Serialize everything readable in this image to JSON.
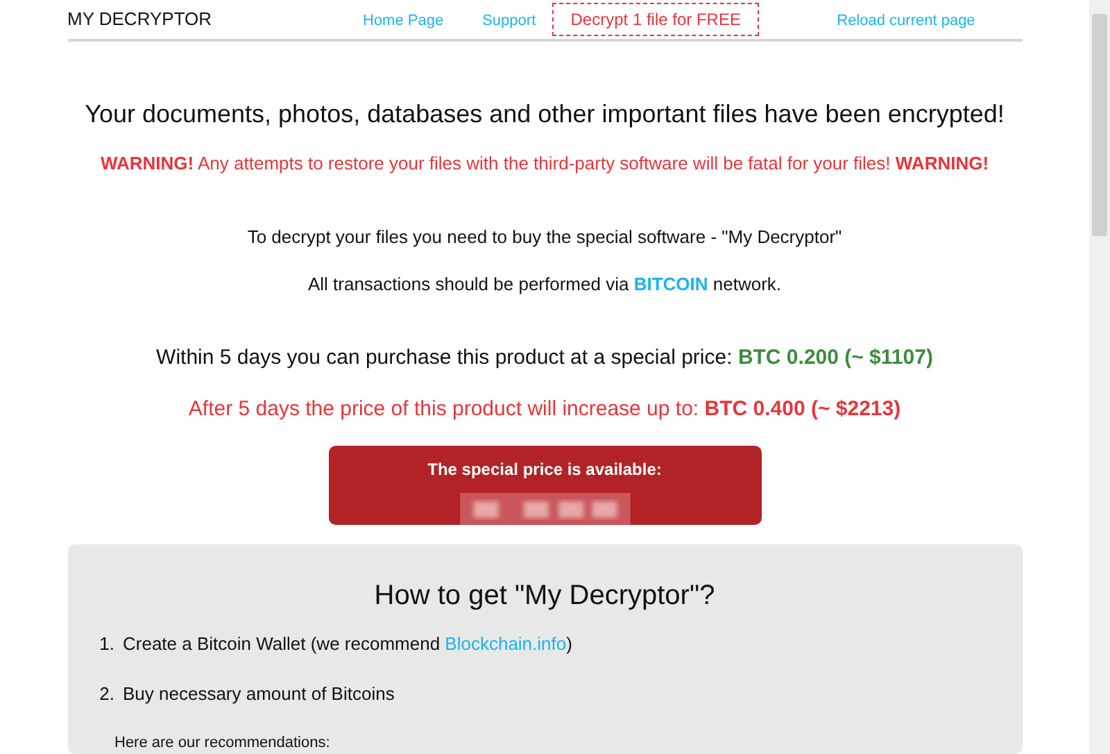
{
  "header": {
    "brand": "MY DECRYPTOR",
    "nav": [
      {
        "label": "Home Page",
        "kind": "link"
      },
      {
        "label": "Support",
        "kind": "link"
      },
      {
        "label": "Decrypt 1 file for FREE",
        "kind": "outlined"
      },
      {
        "label": "Reload current page",
        "kind": "link"
      }
    ]
  },
  "headline": "Your documents, photos, databases and other important files have been encrypted!",
  "paragraphs": [
    {
      "kind": "warning",
      "parts": [
        {
          "text": "WARNING!",
          "kind": "bold"
        },
        {
          "text": " Any attempts to restore your files with the third-party software will be fatal for your files! ",
          "kind": "plain"
        },
        {
          "text": "WARNING!",
          "kind": "bold"
        }
      ]
    },
    {
      "kind": "info",
      "parts": [
        {
          "text": "To decrypt your files you need to buy the special software - \"My Decryptor\"",
          "kind": "plain"
        }
      ]
    },
    {
      "kind": "info",
      "parts": [
        {
          "text": "All transactions should be performed via ",
          "kind": "plain"
        },
        {
          "text": "BITCOIN",
          "kind": "bitcoin"
        },
        {
          "text": " network.",
          "kind": "plain"
        }
      ]
    },
    {
      "kind": "offer",
      "parts": [
        {
          "text": "Within 5 days you can purchase this product at a special price: ",
          "kind": "plain"
        },
        {
          "text": "BTC 0.200 (~ $1107)",
          "kind": "price"
        }
      ]
    },
    {
      "kind": "increase",
      "parts": [
        {
          "text": "After 5 days the price of this product will increase up to: ",
          "kind": "plain"
        },
        {
          "text": "BTC 0.400 (~ $2213)",
          "kind": "bold"
        }
      ]
    }
  ],
  "offer": {
    "title": "The special price is available:"
  },
  "instructions": {
    "title": "How to get \"My Decryptor\"?",
    "steps": [
      {
        "number": "1.",
        "text": "Create a Bitcoin Wallet (we recommend ",
        "link": "Blockchain.info",
        "after": ")"
      },
      {
        "number": "2.",
        "text": "Buy necessary amount of Bitcoins"
      }
    ],
    "note": "Here are our recommendations:"
  }
}
